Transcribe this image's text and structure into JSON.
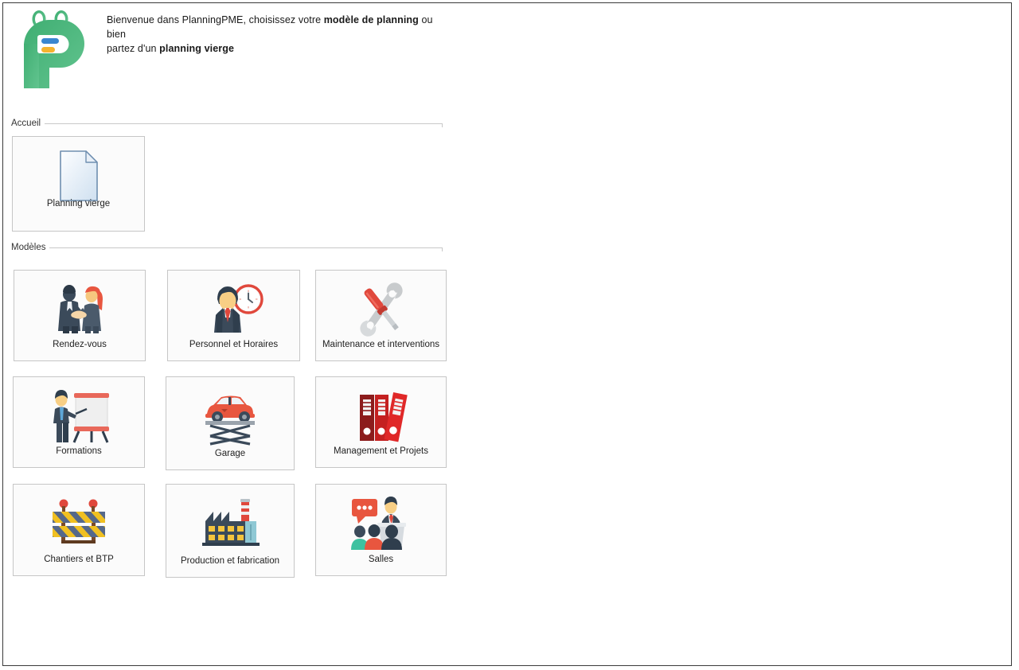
{
  "window": {
    "app_name": "PlanningPME"
  },
  "header": {
    "logo_name": "planningpme-logo",
    "welcome_line1_a": "Bienvenue dans PlanningPME, choisissez votre ",
    "welcome_line1_b": "modèle de planning",
    "welcome_line1_c": " ou bien",
    "welcome_line2_a": "partez d'un ",
    "welcome_line2_b": "planning vierge"
  },
  "groups": [
    {
      "id": "accueil",
      "label": "Accueil"
    },
    {
      "id": "modeles",
      "label": "Modèles"
    }
  ],
  "home_tiles": [
    {
      "id": "planning-vierge",
      "label": "Planning vierge",
      "icon": "blank-document-icon"
    }
  ],
  "template_tiles": [
    {
      "id": "rendez-vous",
      "label": "Rendez-vous",
      "icon": "handshake-icon"
    },
    {
      "id": "personnel-et-horaires",
      "label": "Personnel et Horaires",
      "icon": "businessman-clock-icon"
    },
    {
      "id": "maintenance-interventions",
      "label": "Maintenance et interventions",
      "icon": "wrench-screwdriver-icon"
    },
    {
      "id": "formations",
      "label": "Formations",
      "icon": "trainer-flipchart-icon"
    },
    {
      "id": "garage",
      "label": "Garage",
      "icon": "car-lift-icon"
    },
    {
      "id": "management-et-projets",
      "label": "Management et Projets",
      "icon": "binders-icon"
    },
    {
      "id": "chantiers-et-btp",
      "label": "Chantiers et BTP",
      "icon": "road-barrier-icon"
    },
    {
      "id": "production-et-fabrication",
      "label": "Production et fabrication",
      "icon": "factory-icon"
    },
    {
      "id": "salles",
      "label": "Salles",
      "icon": "conference-speaker-icon"
    }
  ],
  "colors": {
    "logo_green": "#4caf7d",
    "logo_blue": "#3b86d0",
    "logo_yellow": "#f5b32e",
    "accent_red": "#e0483c",
    "dark_navy": "#3b4a5a",
    "binder_dark_red": "#8c1c1c",
    "binder_red": "#d32020",
    "barrier_yellow": "#f0c022",
    "barrier_blue": "#55688a",
    "tile_border": "#c6c6c6",
    "tile_bg": "#fbfbfb",
    "rule": "#c8c8c8",
    "window_border": "#3a3a3a"
  }
}
